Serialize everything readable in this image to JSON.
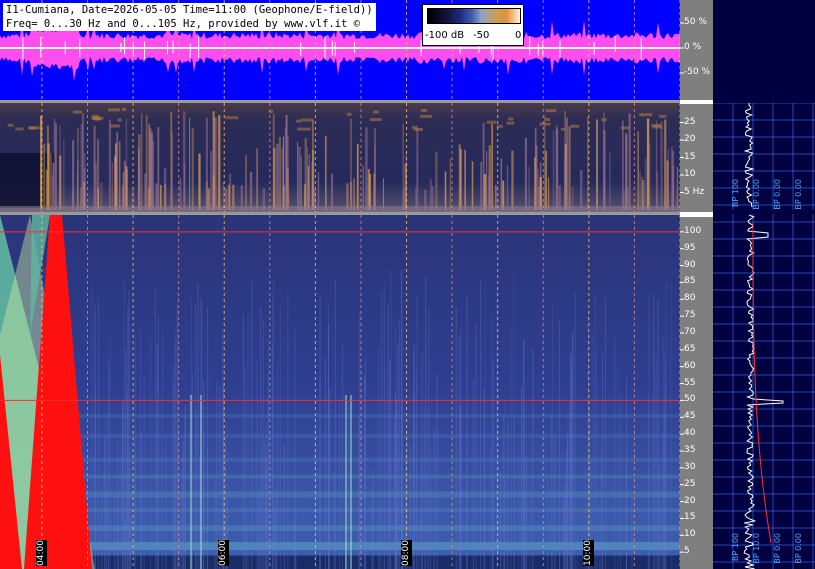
{
  "header": {
    "line1": "I1-Cumiana, Date=2026-05-05 Time=11:00 (Geophone/E-field))",
    "line2": "Freq= 0...30 Hz and 0...105 Hz, provided by www.vlf.it ©"
  },
  "legend": {
    "min_label": "-100 dB",
    "mid_label": "-50",
    "max_label": "0"
  },
  "colors": {
    "waveform_bg": "#0000ff",
    "waveform_fill": "#ff4df0",
    "marker_red": "#ff2a2a",
    "grid_blue": "#3a78ff"
  },
  "chart_data": [
    {
      "type": "area",
      "panel": "waveform",
      "y_unit": "%",
      "yticks": [
        50,
        0,
        -50
      ],
      "ytick_labels": [
        "50 %",
        "0 %",
        "-50 %"
      ]
    },
    {
      "type": "heatmap",
      "panel": "geophone-spectrogram",
      "ylim": [
        0,
        30
      ],
      "yticks": [
        5,
        10,
        15,
        20,
        25
      ],
      "ytick_labels": [
        "5 Hz",
        "10",
        "15",
        "20",
        "25"
      ]
    },
    {
      "type": "heatmap",
      "panel": "efield-spectrogram",
      "ylim": [
        0,
        105
      ],
      "yticks": [
        5,
        10,
        15,
        20,
        25,
        30,
        35,
        40,
        45,
        50,
        55,
        60,
        65,
        70,
        75,
        80,
        85,
        90,
        95,
        100
      ],
      "ytick_labels": [
        "5",
        "10",
        "15",
        "20",
        "25",
        "30",
        "35",
        "40",
        "45",
        "50",
        "55",
        "60",
        "65",
        "70",
        "75",
        "80",
        "85",
        "90",
        "95",
        "100"
      ],
      "time_ticks": [
        "04:00",
        "06:00",
        "08:00",
        "10:00"
      ],
      "time_x": [
        4,
        6,
        8,
        10
      ],
      "xlim": [
        3.54,
        11.0
      ],
      "line_markers_hz": [
        50,
        100
      ]
    },
    {
      "type": "line",
      "panel": "band-power",
      "bp_labels_top": [
        "BP 100",
        "BP 0.00",
        "BP 0.00",
        "BP 0.00"
      ],
      "bp_labels_bottom": [
        "BP 100",
        "BP 10.0",
        "BP 0.00",
        "BP 0.00"
      ]
    }
  ]
}
